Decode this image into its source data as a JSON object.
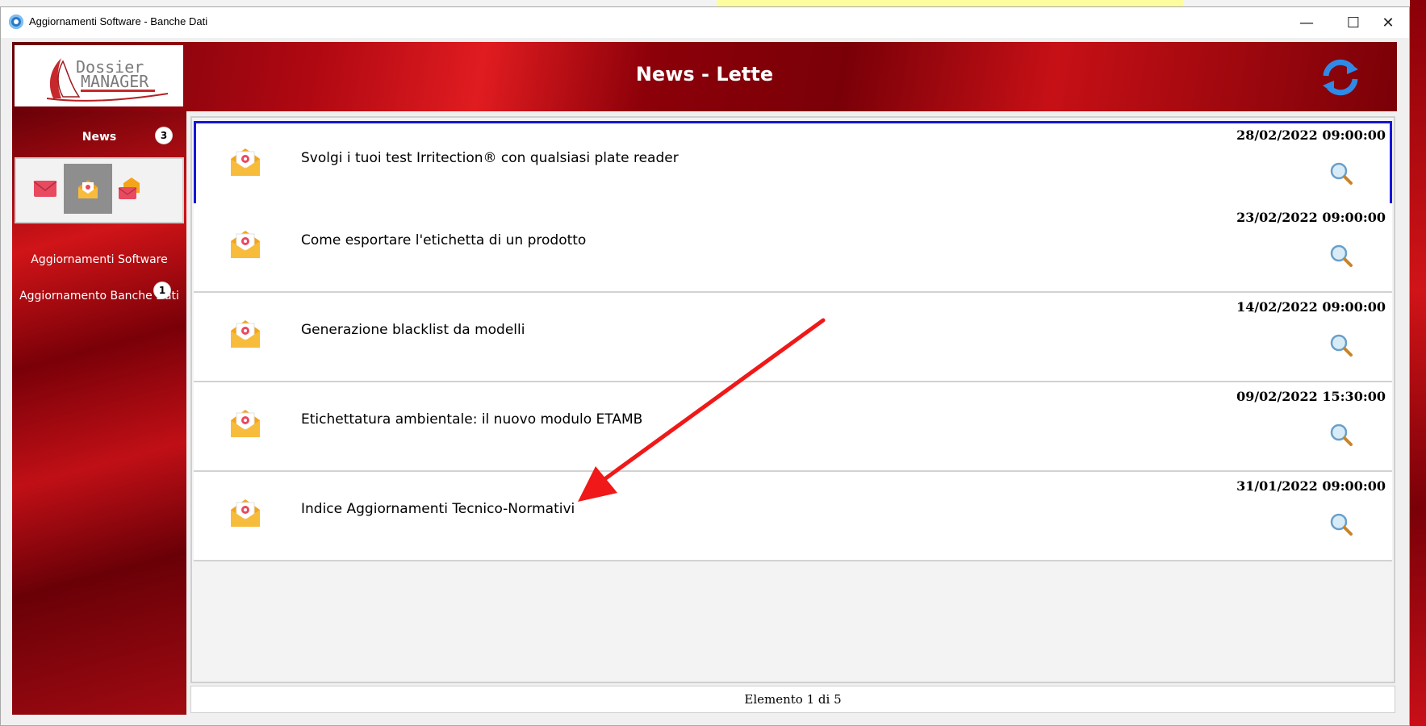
{
  "window": {
    "title": "Aggiornamenti Software - Banche Dati",
    "minimize": "—",
    "maximize": "☐",
    "close": "✕"
  },
  "header": {
    "title": "News - Lette",
    "logo_line1": "Dossier",
    "logo_line2": "MANAGER"
  },
  "sidebar": {
    "news_label": "News",
    "news_badge": "3",
    "software_label": "Aggiornamenti Software",
    "banche_label": "Aggiornamento Banche Dati",
    "banche_badge": "1"
  },
  "news_items": [
    {
      "title": "Svolgi i tuoi test Irritection® con qualsiasi plate reader",
      "date": "28/02/2022 09:00:00",
      "selected": true
    },
    {
      "title": "Come esportare l'etichetta di un prodotto",
      "date": "23/02/2022 09:00:00"
    },
    {
      "title": "Generazione blacklist da modelli",
      "date": "14/02/2022 09:00:00"
    },
    {
      "title": "Etichettatura ambientale: il nuovo modulo ETAMB",
      "date": "09/02/2022 15:30:00"
    },
    {
      "title": "Indice Aggiornamenti Tecnico-Normativi",
      "date": "31/01/2022 09:00:00"
    }
  ],
  "status": {
    "text": "Elemento 1 di 5"
  },
  "colors": {
    "brand_red": "#c8101a",
    "selection_border": "#1515d8"
  },
  "icons": {
    "item": "open-envelope-icon",
    "detail": "magnifier-icon",
    "refresh": "refresh-icon"
  }
}
